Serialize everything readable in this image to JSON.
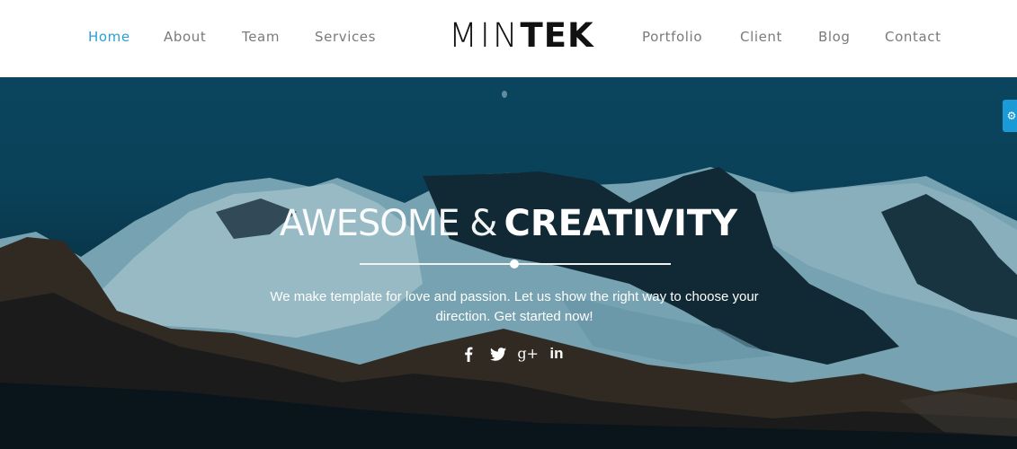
{
  "header": {
    "nav_left": [
      {
        "label": "Home",
        "active": true
      },
      {
        "label": "About",
        "active": false
      },
      {
        "label": "Team",
        "active": false
      },
      {
        "label": "Services",
        "active": false
      }
    ],
    "logo": {
      "light": "MIN",
      "bold": "TEK"
    },
    "nav_right": [
      {
        "label": "Portfolio",
        "active": false
      },
      {
        "label": "Client",
        "active": false
      },
      {
        "label": "Blog",
        "active": false
      },
      {
        "label": "Contact",
        "active": false
      }
    ]
  },
  "hero": {
    "title_light": "AWESOME &",
    "title_bold": "CREATIVITY",
    "description": "We make template for love and passion. Let us show the right way to choose your direction. Get started now!",
    "social": [
      {
        "icon": "facebook-icon",
        "glyph": "f"
      },
      {
        "icon": "twitter-icon",
        "glyph": "bird"
      },
      {
        "icon": "google-plus-icon",
        "glyph": "g+"
      },
      {
        "icon": "linkedin-icon",
        "glyph": "in"
      }
    ]
  },
  "side_tab": {
    "icon": "gear-icon",
    "glyph": "⚙"
  },
  "colors": {
    "accent": "#2a9fd6",
    "nav_text": "#7a7a7a",
    "side_tab": "#1a9bd7"
  }
}
